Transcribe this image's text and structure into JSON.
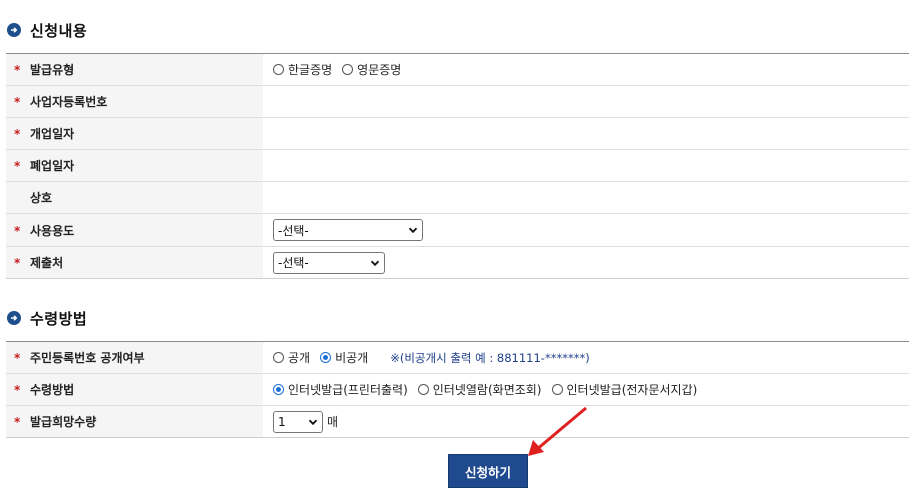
{
  "section1": {
    "title": "신청내용",
    "rows": {
      "issue_type": {
        "label": "발급유형",
        "options": [
          "한글증명",
          "영문증명"
        ]
      },
      "biz_no": {
        "label": "사업자등록번호"
      },
      "open_date": {
        "label": "개업일자"
      },
      "close_date": {
        "label": "폐업일자"
      },
      "trade_name": {
        "label": "상호"
      },
      "purpose": {
        "label": "사용용도",
        "selected": "-선택-"
      },
      "submit_to": {
        "label": "제출처",
        "selected": "-선택-"
      }
    }
  },
  "section2": {
    "title": "수령방법",
    "rows": {
      "disclosure": {
        "label": "주민등록번호 공개여부",
        "options": [
          "공개",
          "비공개"
        ],
        "selected": "비공개",
        "note": "※(비공개시 출력 예 : 881111-*******)"
      },
      "receive": {
        "label": "수령방법",
        "options": [
          "인터넷발급(프린터출력)",
          "인터넷열람(화면조회)",
          "인터넷발급(전자문서지갑)"
        ],
        "selected": "인터넷발급(프린터출력)"
      },
      "quantity": {
        "label": "발급희망수량",
        "selected": "1",
        "unit": "매"
      }
    }
  },
  "required_mark": "*",
  "submit_label": "신청하기",
  "colors": {
    "primary": "#1f4a8d",
    "required": "#c81e1e",
    "arrow": "#e01f1f"
  }
}
